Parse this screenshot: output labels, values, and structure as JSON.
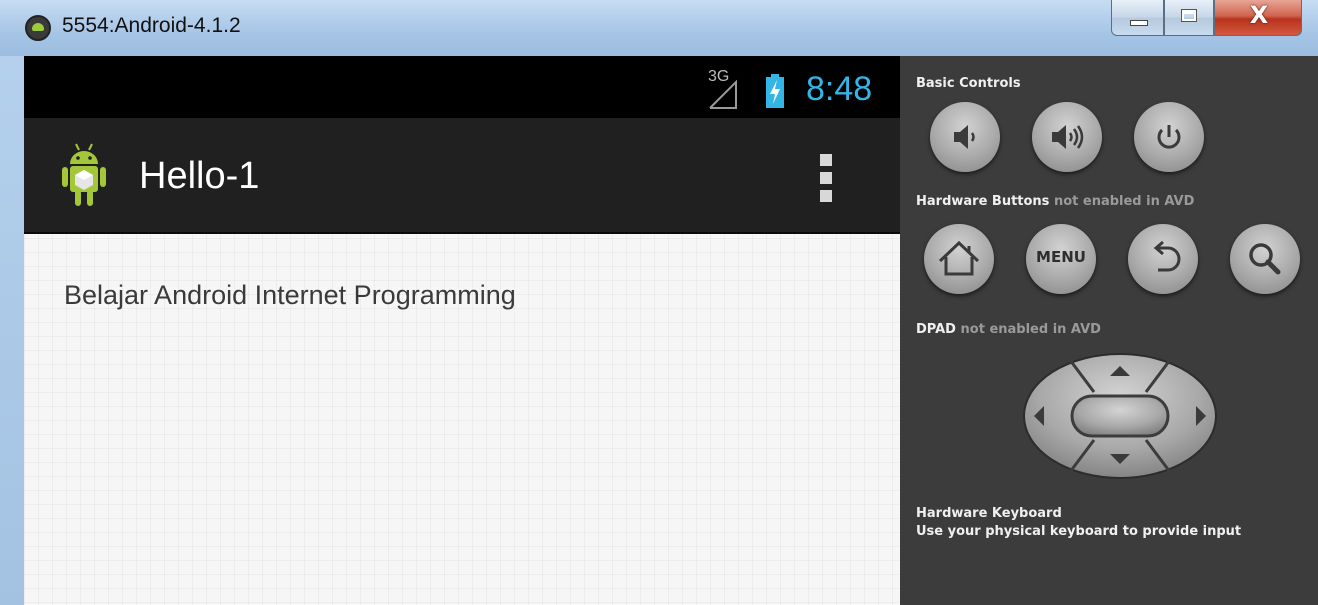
{
  "window": {
    "title": "5554:Android-4.1.2",
    "close_glyph": "X"
  },
  "status_bar": {
    "network": "3G",
    "time": "8:48",
    "clock_color": "#33b5e5"
  },
  "action_bar": {
    "app_title": "Hello-1",
    "app_icon": "android-robot-icon",
    "overflow_icon": "overflow-menu-icon"
  },
  "content": {
    "text": "Belajar Android Internet Programming"
  },
  "controls": {
    "basic_title": "Basic Controls",
    "basic_buttons": [
      "volume-down-icon",
      "volume-up-icon",
      "power-icon"
    ],
    "hardware_title": "Hardware Buttons",
    "hardware_note": "not enabled in AVD",
    "hardware_buttons": [
      "home-icon",
      "menu",
      "back-icon",
      "search-icon"
    ],
    "menu_label": "MENU",
    "dpad_title": "DPAD",
    "dpad_note": "not enabled in AVD",
    "keyboard_title": "Hardware Keyboard",
    "keyboard_note": "Use your physical keyboard to provide input"
  }
}
